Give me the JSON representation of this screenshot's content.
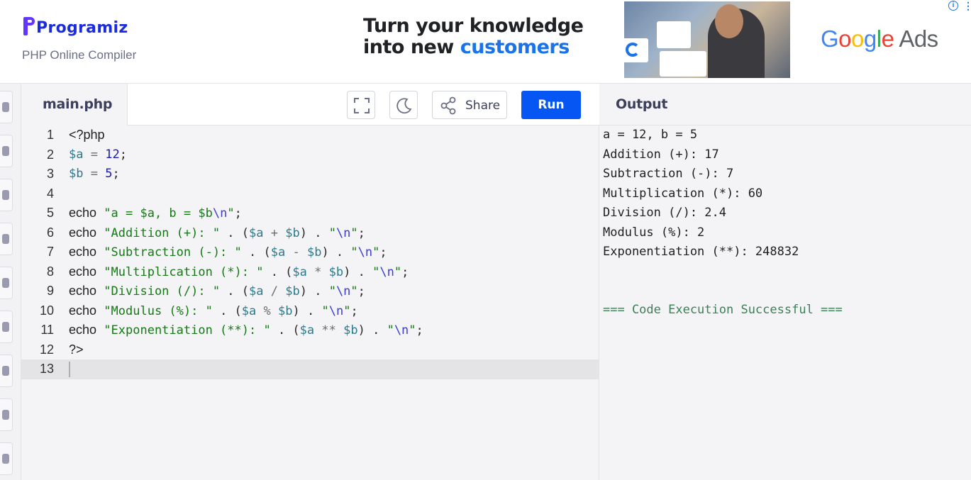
{
  "header": {
    "brand": "Programiz",
    "subtitle": "PHP Online Compiler"
  },
  "ad": {
    "line1": "Turn your knowledge",
    "line2_plain": "into new ",
    "line2_accent": "customers",
    "brand": "Google Ads",
    "info_icon": "info-icon",
    "accent_color": "#1a73e8"
  },
  "editor": {
    "tab_label": "main.php",
    "share_label": "Share",
    "run_label": "Run",
    "run_color": "#0556f3",
    "line_numbers": [
      "1",
      "2",
      "3",
      "4",
      "5",
      "6",
      "7",
      "8",
      "9",
      "10",
      "11",
      "12",
      "13"
    ]
  },
  "output": {
    "title": "Output",
    "lines": [
      "a = 12, b = 5",
      "Addition (+): 17",
      "Subtraction (-): 7",
      "Multiplication (*): 60",
      "Division (/): 2.4",
      "Modulus (%): 2",
      "Exponentiation (**): 248832"
    ],
    "status": "=== Code Execution Successful ==="
  }
}
